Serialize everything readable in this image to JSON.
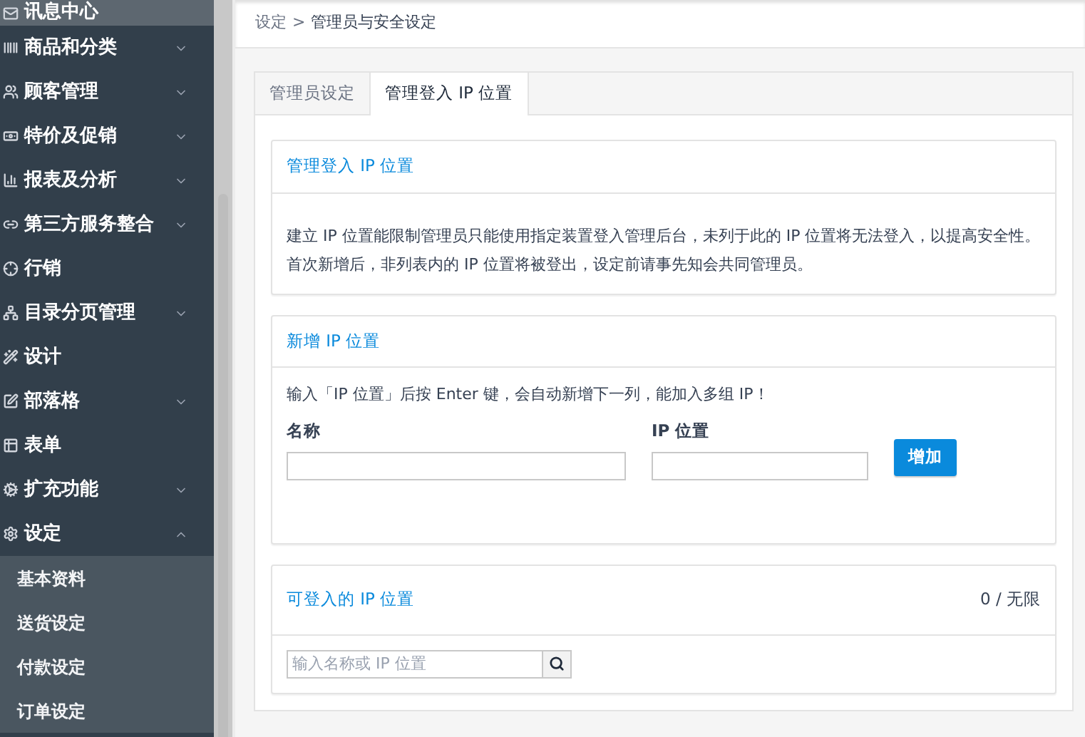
{
  "sidebar": {
    "items": [
      {
        "label": "讯息中心",
        "selected": true
      },
      {
        "label": "商品和分类",
        "selected": false,
        "expanded": false
      },
      {
        "label": "顾客管理",
        "selected": false,
        "expanded": false
      },
      {
        "label": "特价及促销",
        "selected": false,
        "expanded": false
      },
      {
        "label": "报表及分析",
        "selected": false,
        "expanded": false
      },
      {
        "label": "第三方服务整合",
        "selected": false,
        "expanded": false
      },
      {
        "label": "行销",
        "selected": false
      },
      {
        "label": "目录分页管理",
        "selected": false,
        "expanded": false
      },
      {
        "label": "设计",
        "selected": false
      },
      {
        "label": "部落格",
        "selected": false,
        "expanded": false
      },
      {
        "label": "表单",
        "selected": false
      },
      {
        "label": "扩充功能",
        "selected": false,
        "expanded": false
      },
      {
        "label": "设定",
        "selected": false,
        "expanded": true,
        "children": [
          {
            "label": "基本资料",
            "selected": false
          },
          {
            "label": "送货设定",
            "selected": false
          },
          {
            "label": "付款设定",
            "selected": false
          },
          {
            "label": "订单设定",
            "selected": false
          }
        ]
      }
    ]
  },
  "breadcrumb": {
    "parent": "设定",
    "separator": ">",
    "current": "管理员与安全设定"
  },
  "tabs": [
    {
      "label": "管理员设定",
      "selected": false
    },
    {
      "label": "管理登入 IP 位置",
      "selected": true
    }
  ],
  "intro_panel": {
    "title": "管理登入 IP 位置",
    "text": "建立 IP 位置能限制管理员只能使用指定装置登入管理后台，未列于此的 IP 位置将无法登入，以提高安全性。首次新增后，非列表内的 IP 位置将被登出，设定前请事先知会共同管理员。"
  },
  "add_panel": {
    "title": "新增 IP 位置",
    "hint": "输入「IP 位置」后按 Enter 键，会自动新增下一列，能加入多组 IP！",
    "name_label": "名称",
    "ip_label": "IP 位置",
    "button": "增加"
  },
  "list_panel": {
    "title": "可登入的 IP 位置",
    "count": "0 / 无限",
    "search": {
      "placeholder": "输入名称或 IP 位置"
    }
  }
}
